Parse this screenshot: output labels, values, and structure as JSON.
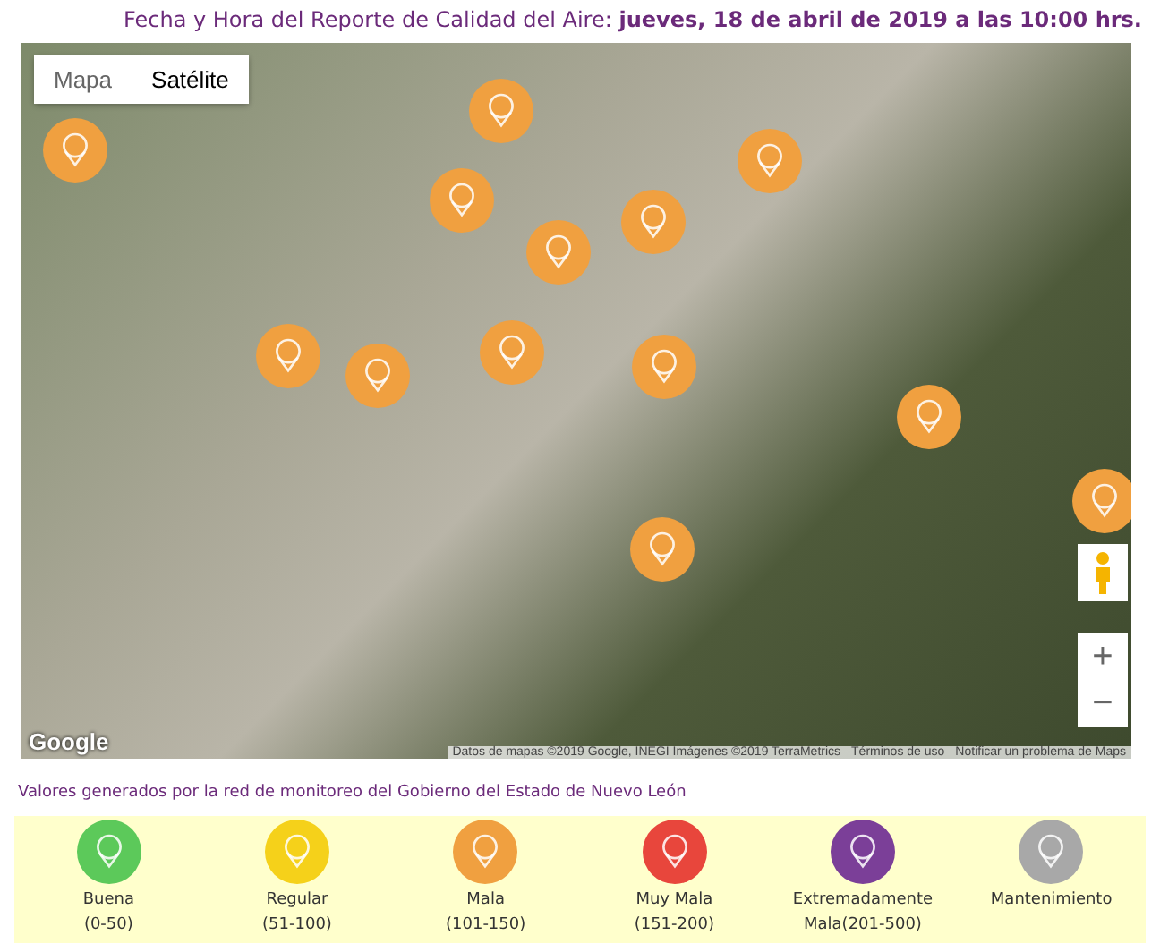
{
  "header": {
    "label": "Fecha y Hora del Reporte de Calidad del Aire:",
    "datetime": "jueves, 18 de abril de 2019 a las 10:00 hrs."
  },
  "map": {
    "tabs": [
      {
        "label": "Mapa",
        "selected": false
      },
      {
        "label": "Satélite",
        "selected": true
      }
    ],
    "markers": [
      {
        "kind": "mala"
      },
      {
        "kind": "mala"
      },
      {
        "kind": "mala"
      },
      {
        "kind": "mala"
      },
      {
        "kind": "mala"
      },
      {
        "kind": "mala"
      },
      {
        "kind": "mala"
      },
      {
        "kind": "mala"
      },
      {
        "kind": "mala"
      },
      {
        "kind": "mala"
      },
      {
        "kind": "mala"
      },
      {
        "kind": "mala"
      },
      {
        "kind": "mala"
      }
    ],
    "zoom_in": "+",
    "zoom_out": "−",
    "logo": "Google",
    "attribution": [
      "Datos de mapas ©2019 Google, INEGI Imágenes ©2019 TerraMetrics",
      "Términos de uso",
      "Notificar un problema de Maps"
    ]
  },
  "source_note": "Valores generados por la red de monitoreo del Gobierno del Estado de Nuevo León",
  "legend": [
    {
      "kind": "buena",
      "label": "Buena",
      "range": "(0-50)"
    },
    {
      "kind": "regular",
      "label": "Regular",
      "range": "(51-100)"
    },
    {
      "kind": "mala",
      "label": "Mala",
      "range": "(101-150)"
    },
    {
      "kind": "muy_mala",
      "label": "Muy Mala",
      "range": "(151-200)"
    },
    {
      "kind": "extremadamente_mala",
      "label": "Extremadamente Mala(201-500)"
    },
    {
      "kind": "mantenimiento",
      "label": "Mantenimiento"
    }
  ]
}
